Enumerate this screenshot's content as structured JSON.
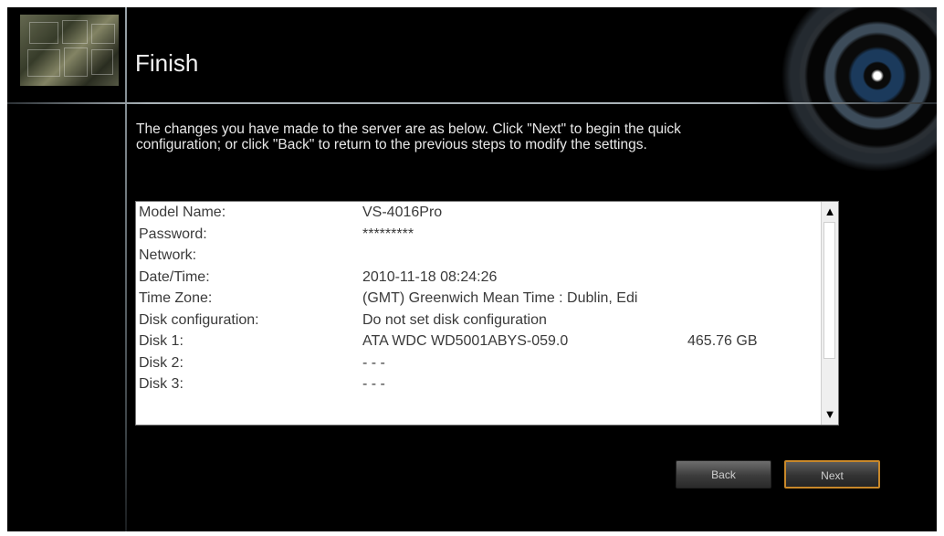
{
  "header": {
    "title": "Finish"
  },
  "description": [
    "The changes you have made to the server are as below. Click \"Next\" to begin the quick",
    "configuration; or click \"Back\" to return to the previous steps to modify the settings."
  ],
  "summary": {
    "rows": [
      {
        "label": "Model Name:",
        "value": "VS-4016Pro",
        "size": ""
      },
      {
        "label": "Password:",
        "value": "*********",
        "size": ""
      },
      {
        "label": "Network:",
        "value": "",
        "size": ""
      },
      {
        "label": "Date/Time:",
        "value": "2010-11-18 08:24:26",
        "size": ""
      },
      {
        "label": "Time Zone:",
        "value": "(GMT) Greenwich Mean Time : Dublin, Edi",
        "size": ""
      },
      {
        "label": "Disk configuration:",
        "value": "Do not set disk configuration",
        "size": ""
      },
      {
        "label": "Disk 1:",
        "value": "ATA    WDC WD5001ABYS-059.0",
        "size": "465.76 GB"
      },
      {
        "label": "Disk 2:",
        "value": "- - -",
        "size": ""
      },
      {
        "label": "Disk 3:",
        "value": "- - -",
        "size": ""
      }
    ],
    "scroll_up_icon": "▲",
    "scroll_down_icon": "▼"
  },
  "buttons": {
    "back": "Back",
    "next": "Next"
  },
  "colors": {
    "background": "#000000",
    "next_border": "#c8882a"
  }
}
